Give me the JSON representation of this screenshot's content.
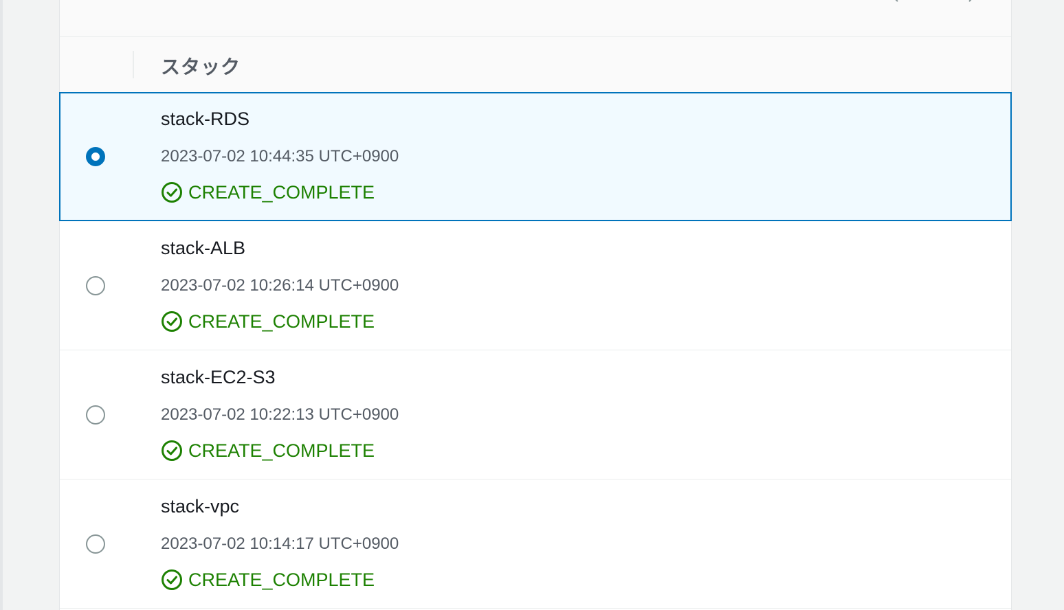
{
  "table": {
    "column_header": "スタック",
    "rows": [
      {
        "name": "stack-RDS",
        "created": "2023-07-02 10:44:35 UTC+0900",
        "status": "CREATE_COMPLETE",
        "selected": true
      },
      {
        "name": "stack-ALB",
        "created": "2023-07-02 10:26:14 UTC+0900",
        "status": "CREATE_COMPLETE",
        "selected": false
      },
      {
        "name": "stack-EC2-S3",
        "created": "2023-07-02 10:22:13 UTC+0900",
        "status": "CREATE_COMPLETE",
        "selected": false
      },
      {
        "name": "stack-vpc",
        "created": "2023-07-02 10:14:17 UTC+0900",
        "status": "CREATE_COMPLETE",
        "selected": false
      }
    ]
  },
  "icons": {
    "status": "check-circle-icon",
    "pager_prev": "chevron-left-icon",
    "pager_next": "chevron-right-icon"
  },
  "colors": {
    "accent": "#0073bb",
    "success": "#1d8102",
    "selected_bg": "#f1faff",
    "header_text": "#545b64"
  }
}
